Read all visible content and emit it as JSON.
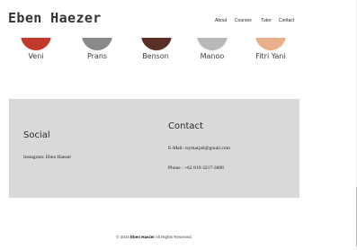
{
  "header": {
    "brand": "Eben Haezer",
    "nav": [
      "About",
      "Courses",
      "Tutor",
      "Contact"
    ]
  },
  "tutors": [
    {
      "name": "Veni",
      "avatar_color": "#c0392b"
    },
    {
      "name": "Prans",
      "avatar_color": "#8a8a8a"
    },
    {
      "name": "Benson",
      "avatar_color": "#5a2f27"
    },
    {
      "name": "Manoo",
      "avatar_color": "#b9b9b9"
    },
    {
      "name": "Fitri Yani",
      "avatar_color": "#e9b08b"
    }
  ],
  "footer": {
    "social_heading": "Social",
    "social_instagram": "Instagram: Eben Haezer",
    "contact_heading": "Contact",
    "contact_email": "E-Mail: rsymarja6@gmail.com",
    "contact_phone": "Phone : +62 819-3217-3888",
    "panel_color": "#d9d9d9"
  },
  "copyright": {
    "prefix": "© 2024",
    "brand": "Eben Haezer",
    "suffix": "All Rights Reserved."
  }
}
